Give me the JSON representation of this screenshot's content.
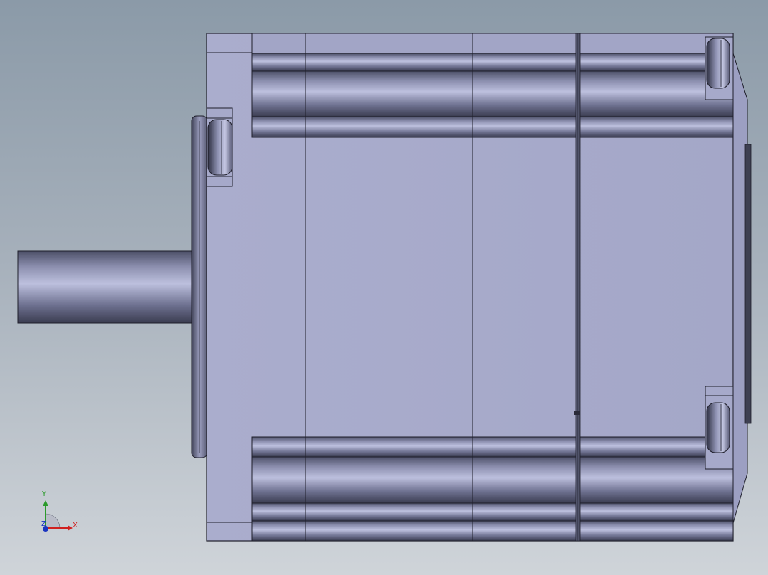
{
  "viewport": {
    "background_top": "#8b9aa8",
    "background_bottom": "#cfd4d9",
    "model_face_color": "#a8abcc",
    "edge_color": "#1e1e2a"
  },
  "model": {
    "parts": [
      "motor-shaft",
      "mounting-flange",
      "front-end-cap",
      "stator-body",
      "rear-end-cap",
      "rear-cover",
      "mounting-screws",
      "rear-connector"
    ]
  },
  "triad": {
    "x_label": "X",
    "y_label": "Y",
    "z_label": "Z",
    "x_color": "#d02020",
    "y_color": "#2a9a2a",
    "z_color": "#1a35c0"
  }
}
